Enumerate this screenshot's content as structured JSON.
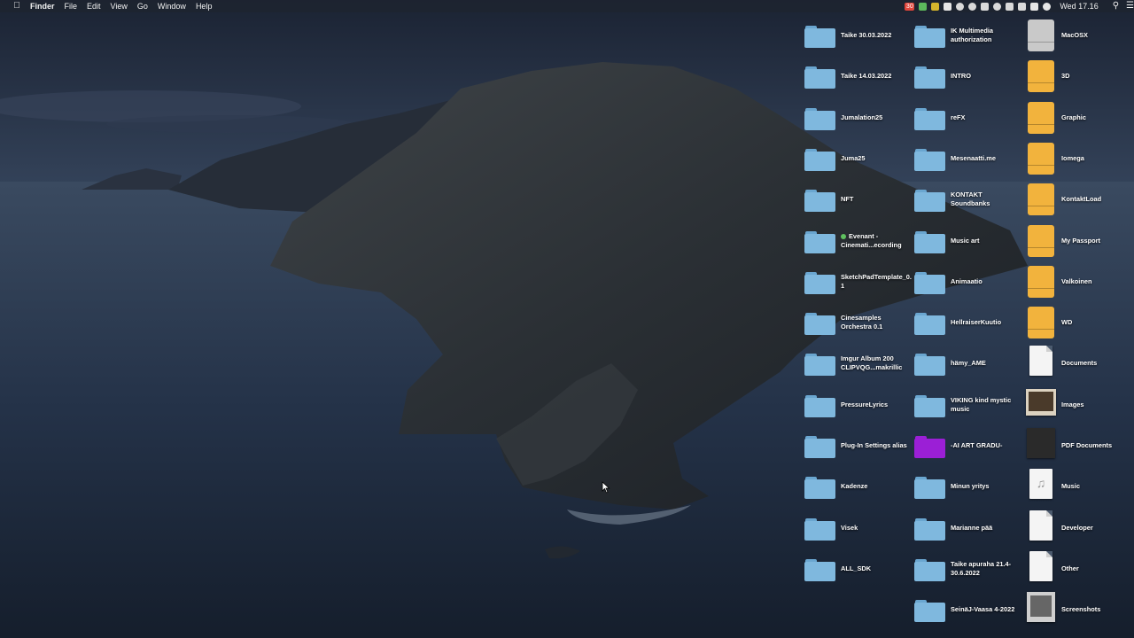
{
  "menubar": {
    "apple_icon": "apple-icon",
    "app_name": "Finder",
    "menus": [
      "File",
      "Edit",
      "View",
      "Go",
      "Window",
      "Help"
    ],
    "status_icons": [
      {
        "name": "calendar-date-icon",
        "text": "30",
        "color": "#e0463c"
      },
      {
        "name": "app-status-icon-green",
        "color": "#5cb85c"
      },
      {
        "name": "app-status-icon-yellow",
        "color": "#d4b42c"
      },
      {
        "name": "cloud-icon",
        "color": "#e6e6e6"
      },
      {
        "name": "camera-icon",
        "color": "#d9d9d9"
      },
      {
        "name": "creative-cloud-icon",
        "color": "#d9d9d9"
      },
      {
        "name": "dropbox-icon",
        "color": "#d9d9d9"
      },
      {
        "name": "sync-icon",
        "color": "#d9d9d9"
      },
      {
        "name": "shield-icon",
        "color": "#d9d9d9"
      },
      {
        "name": "grid-icon",
        "color": "#d9d9d9"
      },
      {
        "name": "battery-icon",
        "color": "#e6e6e6"
      },
      {
        "name": "wifi-icon",
        "color": "#e6e6e6"
      }
    ],
    "clock": "Wed 17.16",
    "search_icon": "search-icon",
    "list_icon": "control-center-icon"
  },
  "desktop": {
    "columns": [
      [
        {
          "label": "Taike 30.03.2022",
          "kind": "folder"
        },
        {
          "label": "Taike 14.03.2022",
          "kind": "folder"
        },
        {
          "label": "Jumalation25",
          "kind": "folder"
        },
        {
          "label": "Juma25",
          "kind": "folder"
        },
        {
          "label": "NFT",
          "kind": "folder"
        },
        {
          "label": "Evenant - Cinemati...ecording",
          "kind": "folder",
          "tag": "green"
        },
        {
          "label": "SketchPadTemplate_0.1",
          "kind": "folder"
        },
        {
          "label": "Cinesamples Orchestra 0.1",
          "kind": "folder"
        },
        {
          "label": "Imgur Album 200 CLIPVQG...makrillic",
          "kind": "folder"
        },
        {
          "label": "PressureLyrics",
          "kind": "folder"
        },
        {
          "label": "Plug-In Settings alias",
          "kind": "folder"
        },
        {
          "label": "Kadenze",
          "kind": "folder"
        },
        {
          "label": "Visek",
          "kind": "folder"
        },
        {
          "label": "ALL_SDK",
          "kind": "folder"
        }
      ],
      [
        {
          "label": "IK Multimedia authorization",
          "kind": "folder"
        },
        {
          "label": "INTRO",
          "kind": "folder"
        },
        {
          "label": "reFX",
          "kind": "folder"
        },
        {
          "label": "Mesenaatti.me",
          "kind": "folder"
        },
        {
          "label": "KONTAKT Soundbanks",
          "kind": "folder"
        },
        {
          "label": "Music art",
          "kind": "folder"
        },
        {
          "label": "Animaatio",
          "kind": "folder"
        },
        {
          "label": "HellraiserKuutio",
          "kind": "folder"
        },
        {
          "label": "hämy_AME",
          "kind": "folder"
        },
        {
          "label": "VIKING kind mystic music",
          "kind": "folder"
        },
        {
          "label": "-AI ART GRADU-",
          "kind": "folder-purple"
        },
        {
          "label": "Minun yritys",
          "kind": "folder"
        },
        {
          "label": "Marianne pää",
          "kind": "folder"
        },
        {
          "label": "Taike apuraha 21.4-30.6.2022",
          "kind": "folder"
        },
        {
          "label": "SeinäJ-Vaasa 4-2022",
          "kind": "folder"
        }
      ],
      [
        {
          "label": "MacOSX",
          "kind": "drive-internal"
        },
        {
          "label": "3D",
          "kind": "drive"
        },
        {
          "label": "Graphic",
          "kind": "drive"
        },
        {
          "label": "Iomega",
          "kind": "drive"
        },
        {
          "label": "KontaktLoad",
          "kind": "drive"
        },
        {
          "label": "My Passport",
          "kind": "drive"
        },
        {
          "label": "Valkoinen",
          "kind": "drive"
        },
        {
          "label": "WD",
          "kind": "drive"
        },
        {
          "label": "Documents",
          "kind": "doc"
        },
        {
          "label": "Images",
          "kind": "images"
        },
        {
          "label": "PDF Documents",
          "kind": "pdf"
        },
        {
          "label": "Music",
          "kind": "music"
        },
        {
          "label": "Developer",
          "kind": "doc"
        },
        {
          "label": "Other",
          "kind": "doc"
        },
        {
          "label": "Screenshots",
          "kind": "screenshots"
        }
      ]
    ]
  },
  "colors": {
    "folder": "#7fb8de",
    "folder_tab": "#6aa6d0",
    "folder_purple": "#9b1fd6",
    "drive": "#f2b33d",
    "drive_internal": "#c9c9c9"
  }
}
